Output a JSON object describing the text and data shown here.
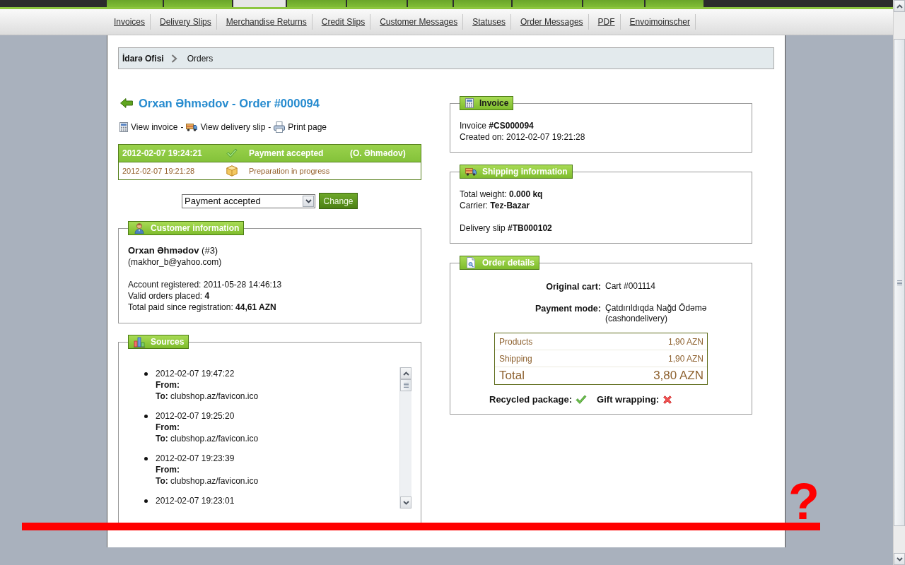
{
  "top_tabs": [
    {
      "selected": false
    },
    {
      "selected": false
    },
    {
      "selected": true
    },
    {
      "selected": false
    },
    {
      "selected": false
    },
    {
      "selected": false
    },
    {
      "selected": false
    },
    {
      "selected": false
    },
    {
      "selected": false
    },
    {
      "selected": false
    }
  ],
  "subnav": [
    "Invoices",
    "Delivery Slips",
    "Merchandise Returns",
    "Credit Slips",
    "Customer Messages",
    "Statuses",
    "Order Messages",
    "PDF",
    "Envoimoinscher"
  ],
  "breadcrumb": {
    "home": "İdarə Ofisi",
    "current": "Orders"
  },
  "order": {
    "title": "Orxan Əhmədov - Order #000094",
    "actions": [
      {
        "kind": "invoice",
        "label": "View invoice",
        "separator": "-"
      },
      {
        "kind": "delivery",
        "label": "View delivery slip",
        "separator": "-"
      },
      {
        "kind": "print",
        "label": "Print page"
      }
    ],
    "status_history": [
      {
        "date": "2012-02-07 19:24:21",
        "kind": "accepted",
        "status": "Payment accepted",
        "employee": "(O. Əhmədov)",
        "current": true
      },
      {
        "date": "2012-02-07 19:21:28",
        "kind": "preparation",
        "status": "Preparation in progress",
        "current": false
      }
    ],
    "status_select": {
      "value": "Payment accepted"
    },
    "change_button": "Change"
  },
  "customer_panel": {
    "title": "Customer information",
    "title_link": false,
    "name_line": "**Orxan Əhmədov** (#3)",
    "email": "(makhor_b@yahoo.com)",
    "lines": [
      "Account registered: 2011-05-28 14:46:13",
      "Valid orders placed: **4**",
      "Total paid since registration: **44,61 AZN**"
    ]
  },
  "sources_panel": {
    "title": "Sources",
    "title_link": false,
    "entries": [
      {
        "date": "2012-02-07 19:47:22",
        "from": "From:",
        "to": "**To:** clubshop.az/favicon.ico"
      },
      {
        "date": "2012-02-07 19:25:20",
        "from": "From:",
        "to": "**To:** clubshop.az/favicon.ico"
      },
      {
        "date": "2012-02-07 19:23:39",
        "from": "From:",
        "to": "**To:** clubshop.az/favicon.ico"
      },
      {
        "date": "2012-02-07 19:23:01"
      }
    ]
  },
  "invoice_panel": {
    "title": "Invoice",
    "title_link": true,
    "lines": [
      "Invoice **#CS000094**",
      "Created on: 2012-02-07 19:21:28"
    ]
  },
  "shipping_panel": {
    "title": "Shipping information",
    "title_link": false,
    "lines": [
      "Total weight: **0.000 kq**",
      "Carrier: **Tez-Bazar**"
    ],
    "slip": "Delivery slip **#TB000102**"
  },
  "order_details_panel": {
    "title": "Order details",
    "title_link": false,
    "fields": [
      {
        "label": "Original cart:",
        "value": "Cart #001114"
      },
      {
        "label": "Payment mode:",
        "value": "Çatdırıldıqda Nağd Ödəmə (cashondelivery)"
      }
    ],
    "totals": [
      {
        "kind": "line",
        "label": "Products",
        "amount": "1,90 AZN"
      },
      {
        "kind": "line",
        "label": "Shipping",
        "amount": "1,90 AZN"
      },
      {
        "kind": "total",
        "label": "Total",
        "amount": "3,80 AZN"
      }
    ],
    "options": [
      {
        "label": "Recycled package:",
        "on": true
      },
      {
        "label": "Gift wrapping:",
        "on": false
      }
    ]
  },
  "annotation": {
    "mark": "?"
  }
}
